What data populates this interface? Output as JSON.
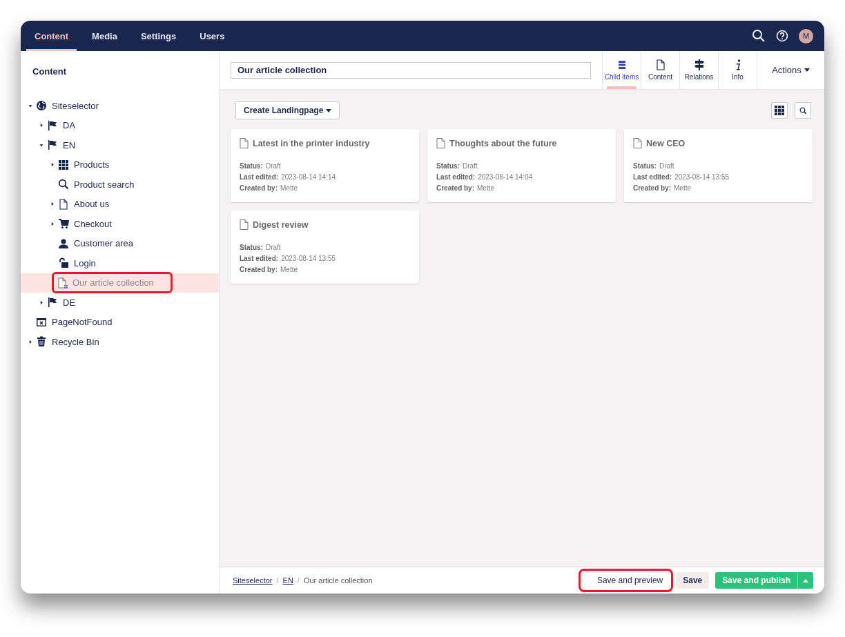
{
  "top_nav": {
    "sections": [
      {
        "label": "Content",
        "selected": true
      },
      {
        "label": "Media",
        "selected": false
      },
      {
        "label": "Settings",
        "selected": false
      },
      {
        "label": "Users",
        "selected": false
      }
    ],
    "user_initial": "M"
  },
  "sidebar": {
    "title": "Content",
    "tree": [
      {
        "label": "Siteselector",
        "kind": "globe",
        "expanded": true,
        "selected": false,
        "highlighted": false,
        "children": [
          {
            "label": "DA",
            "kind": "flag",
            "expanded": false,
            "selected": false,
            "highlighted": false
          },
          {
            "label": "EN",
            "kind": "flag",
            "expanded": true,
            "selected": false,
            "highlighted": false,
            "children": [
              {
                "label": "Products",
                "kind": "grid",
                "expanded": false,
                "selected": false,
                "highlighted": false
              },
              {
                "label": "Product search",
                "kind": "search",
                "selected": false,
                "highlighted": false
              },
              {
                "label": "About us",
                "kind": "document",
                "expanded": false,
                "selected": false,
                "highlighted": false
              },
              {
                "label": "Checkout",
                "kind": "cart",
                "expanded": false,
                "selected": false,
                "highlighted": false
              },
              {
                "label": "Customer area",
                "kind": "user",
                "selected": false,
                "highlighted": false
              },
              {
                "label": "Login",
                "kind": "unlock",
                "selected": false,
                "highlighted": false
              },
              {
                "label": "Our article collection",
                "kind": "collection",
                "selected": true,
                "highlighted": true
              }
            ]
          },
          {
            "label": "DE",
            "kind": "flag",
            "expanded": false,
            "selected": false,
            "highlighted": false
          }
        ]
      },
      {
        "label": "PageNotFound",
        "kind": "errorpage",
        "selected": false,
        "highlighted": false
      },
      {
        "label": "Recycle Bin",
        "kind": "trash",
        "expanded": false,
        "selected": false,
        "highlighted": false
      }
    ]
  },
  "editor": {
    "name_value": "Our article collection",
    "views": [
      {
        "label": "Child items",
        "kind": "list",
        "selected": true
      },
      {
        "label": "Content",
        "kind": "document",
        "selected": false
      },
      {
        "label": "Relations",
        "kind": "signpost",
        "selected": false
      },
      {
        "label": "Info",
        "kind": "info",
        "selected": false
      }
    ],
    "actions_label": "Actions",
    "create_button": "Create Landingpage",
    "cards": [
      {
        "title": "Latest in the printer industry",
        "fields": [
          {
            "label": "Status:",
            "value": "Draft"
          },
          {
            "label": "Last edited:",
            "value": "2023-08-14 14:14"
          },
          {
            "label": "Created by:",
            "value": "Mette"
          }
        ]
      },
      {
        "title": "Thoughts about the future",
        "fields": [
          {
            "label": "Status:",
            "value": "Draft"
          },
          {
            "label": "Last edited:",
            "value": "2023-08-14 14:04"
          },
          {
            "label": "Created by:",
            "value": "Mette"
          }
        ]
      },
      {
        "title": "New CEO",
        "fields": [
          {
            "label": "Status:",
            "value": "Draft"
          },
          {
            "label": "Last edited:",
            "value": "2023-08-14 13:55"
          },
          {
            "label": "Created by:",
            "value": "Mette"
          }
        ]
      },
      {
        "title": "Digest review",
        "fields": [
          {
            "label": "Status:",
            "value": "Draft"
          },
          {
            "label": "Last edited:",
            "value": "2023-08-14 13:55"
          },
          {
            "label": "Created by:",
            "value": "Mette"
          }
        ]
      }
    ]
  },
  "footer": {
    "breadcrumbs": [
      {
        "label": "Siteselector",
        "link": true
      },
      {
        "separator": "/",
        "label": "EN",
        "link": true
      },
      {
        "separator": "/",
        "label": "Our article collection",
        "link": false
      }
    ],
    "buttons": [
      {
        "label": "Save and preview",
        "kind": "plain",
        "highlighted": true
      },
      {
        "label": "Save",
        "kind": "secondary",
        "highlighted": false
      },
      {
        "label": "Save and publish",
        "kind": "primary",
        "highlighted": false
      }
    ]
  }
}
